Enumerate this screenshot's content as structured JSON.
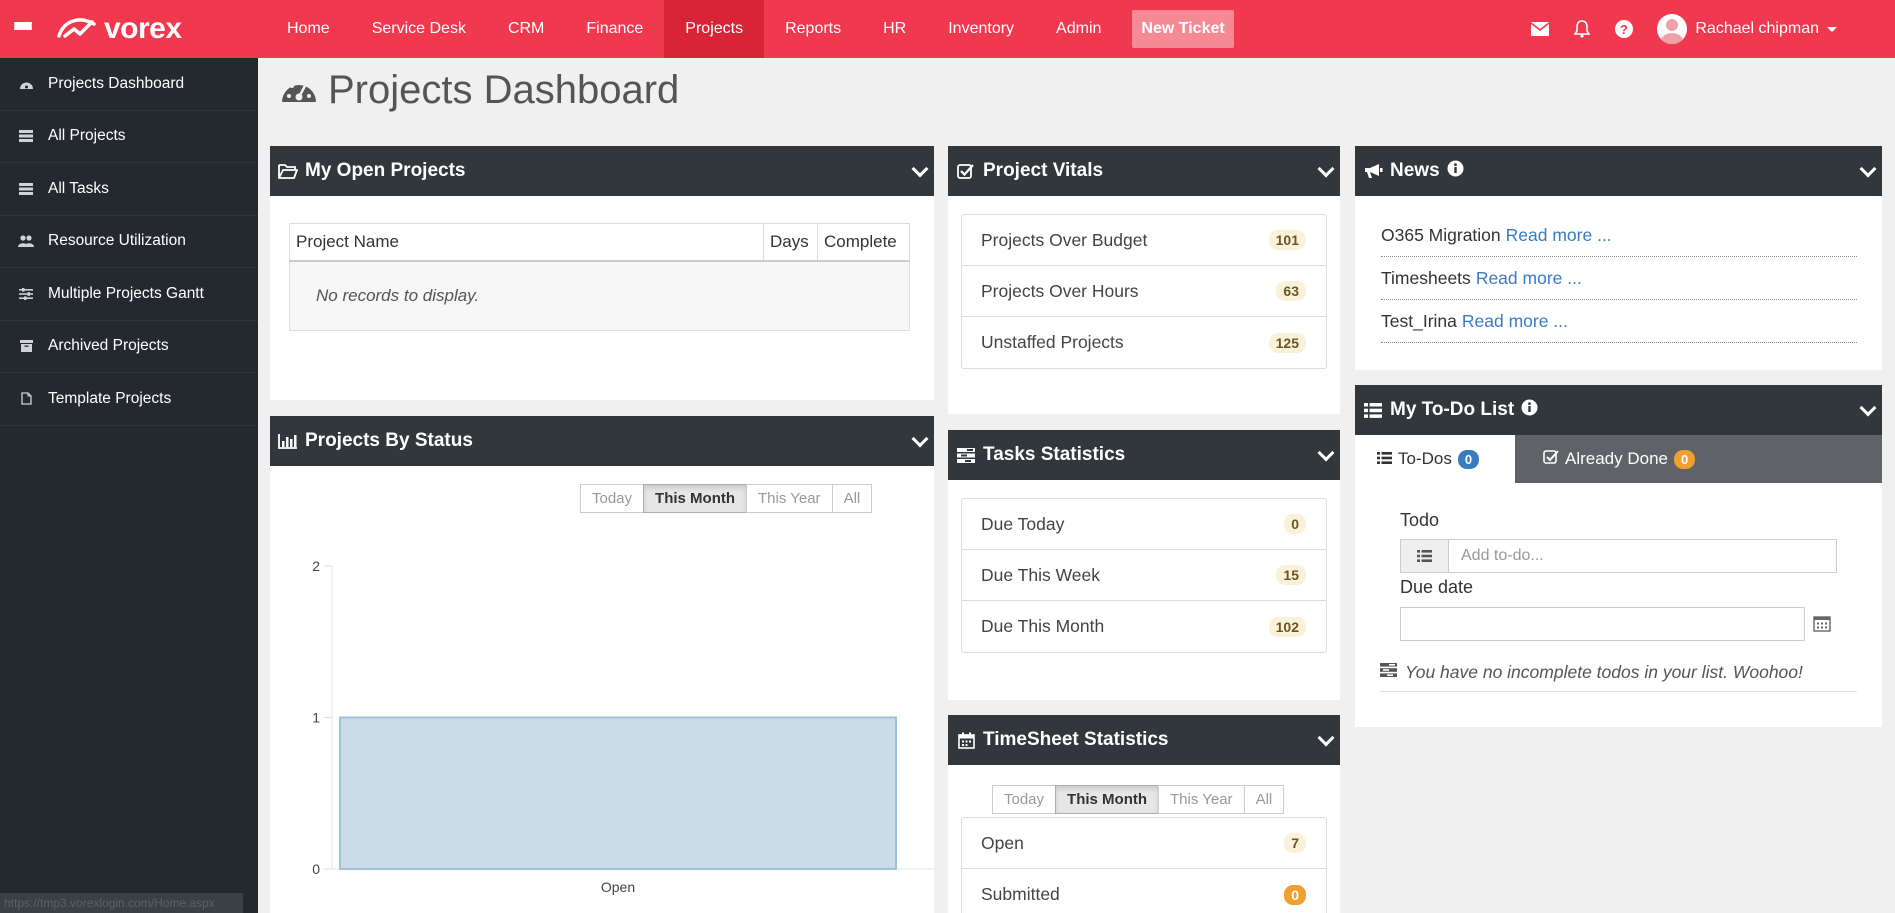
{
  "brand": {
    "name": "vorex"
  },
  "nav": [
    {
      "label": "Home",
      "active": false
    },
    {
      "label": "Service Desk",
      "active": false
    },
    {
      "label": "CRM",
      "active": false
    },
    {
      "label": "Finance",
      "active": false
    },
    {
      "label": "Projects",
      "active": true
    },
    {
      "label": "Reports",
      "active": false
    },
    {
      "label": "HR",
      "active": false
    },
    {
      "label": "Inventory",
      "active": false
    },
    {
      "label": "Admin",
      "active": false
    }
  ],
  "new_ticket": "New Ticket",
  "user": {
    "name": "Rachael chipman"
  },
  "sidebar": {
    "items": [
      {
        "label": "Projects Dashboard",
        "icon": "dashboard-icon"
      },
      {
        "label": "All Projects",
        "icon": "tasks-icon"
      },
      {
        "label": "All Tasks",
        "icon": "tasks-icon"
      },
      {
        "label": "Resource Utilization",
        "icon": "users-icon"
      },
      {
        "label": "Multiple Projects Gantt",
        "icon": "sliders-icon"
      },
      {
        "label": "Archived Projects",
        "icon": "archive-icon"
      },
      {
        "label": "Template Projects",
        "icon": "file-icon"
      }
    ],
    "status_url": "https://tmp3.vorexlogin.com/Home.aspx"
  },
  "page": {
    "title": "Projects Dashboard"
  },
  "open_projects": {
    "title": "My Open Projects",
    "columns": [
      "Project Name",
      "Days",
      "Complete"
    ],
    "empty": "No records to display."
  },
  "vitals": {
    "title": "Project Vitals",
    "rows": [
      {
        "label": "Projects Over Budget",
        "count": "101"
      },
      {
        "label": "Projects Over Hours",
        "count": "63"
      },
      {
        "label": "Unstaffed Projects",
        "count": "125"
      }
    ]
  },
  "news": {
    "title": "News",
    "read_more": "Read more ...",
    "items": [
      {
        "title": "O365 Migration"
      },
      {
        "title": "Timesheets"
      },
      {
        "title": "Test_Irina"
      }
    ]
  },
  "by_status": {
    "title": "Projects By Status",
    "filters": [
      "Today",
      "This Month",
      "This Year",
      "All"
    ],
    "active_filter": "This Month"
  },
  "tasks": {
    "title": "Tasks Statistics",
    "rows": [
      {
        "label": "Due Today",
        "count": "0"
      },
      {
        "label": "Due This Week",
        "count": "15"
      },
      {
        "label": "Due This Month",
        "count": "102"
      }
    ]
  },
  "timesheet": {
    "title": "TimeSheet Statistics",
    "filters": [
      "Today",
      "This Month",
      "This Year",
      "All"
    ],
    "active_filter": "This Month",
    "rows": [
      {
        "label": "Open",
        "count": "7"
      },
      {
        "label": "Submitted",
        "count": "0"
      }
    ]
  },
  "todo": {
    "title": "My To-Do List",
    "tabs": [
      {
        "label": "To-Dos",
        "count": "0"
      },
      {
        "label": "Already Done",
        "count": "0"
      }
    ],
    "todo_label": "Todo",
    "todo_placeholder": "Add to-do...",
    "due_label": "Due date",
    "due_value": "",
    "empty": "You have no incomplete todos in your list. Woohoo!"
  },
  "colors": {
    "brand": "#f0384e",
    "nav_active": "#d92438",
    "sidebar": "#23292e",
    "panel_head": "#32373c",
    "bar_fill": "#c9dce7"
  },
  "chart_data": {
    "type": "bar",
    "categories": [
      "Open"
    ],
    "values": [
      1
    ],
    "ylim": [
      0,
      2
    ],
    "yticks": [
      0,
      1,
      2
    ],
    "grid": false
  }
}
